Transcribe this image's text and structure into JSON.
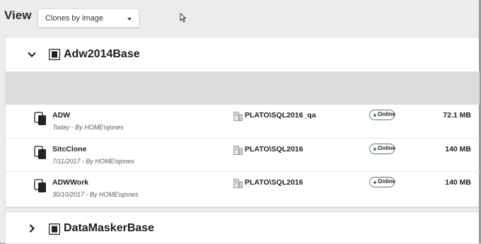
{
  "view": {
    "label": "View",
    "select_value": "Clones by image"
  },
  "groups": [
    {
      "title": "Adw2014Base",
      "expanded": true,
      "clones": [
        {
          "name": "ADW",
          "meta": "Today - By HOME\\sjones",
          "server": "PLATO\\SQL2016_qa",
          "status": "Online",
          "size": "72.1 MB"
        },
        {
          "name": "SitcClone",
          "meta": "7/11/2017 - By HOME\\sjones",
          "server": "PLATO\\SQL2016",
          "status": "Online",
          "size": "140 MB"
        },
        {
          "name": "ADWWork",
          "meta": "30/10/2017 - By HOME\\sjones",
          "server": "PLATO\\SQL2016",
          "status": "Online",
          "size": "140 MB"
        }
      ]
    },
    {
      "title": "DataMaskerBase",
      "expanded": false
    }
  ],
  "icons": {
    "view_dropdown": "caret-down-icon",
    "expand_group": "chevron-down-icon",
    "collapse_group": "chevron-right-icon",
    "image": "database-image-icon",
    "clone": "clone-stack-icon",
    "server": "server-icon",
    "online_dot": "status-dot-icon",
    "cursor": "mouse-pointer-icon"
  },
  "colors": {
    "online": "#2e9c3c",
    "band": "#dcdcdc",
    "background": "#ececec"
  }
}
